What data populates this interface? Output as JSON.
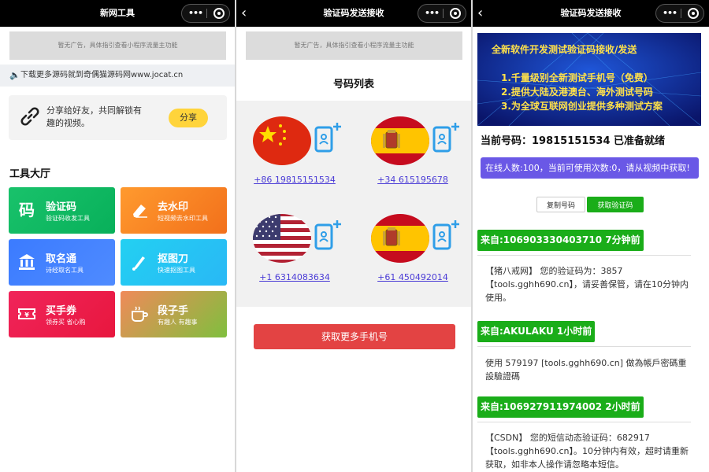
{
  "panel1": {
    "nav_title": "新网工具",
    "ad_text": "暂无广告，具体指引查看小程序流量主功能",
    "notice": "下载更多源码就到奇偶猫源码网www.jocat.cn",
    "share_text": "分享给好友，共同解锁有趣的视频。",
    "share_button": "分享",
    "section_title": "工具大厅",
    "tools": [
      {
        "name": "验证码",
        "sub": "验证码收发工具",
        "icon": "码",
        "color_from": "#19c26b",
        "color_to": "#08b05a"
      },
      {
        "name": "去水印",
        "sub": "短视频去水印工具",
        "icon": "eraser-icon",
        "color_from": "#ff9a2e",
        "color_to": "#f2701b"
      },
      {
        "name": "取名通",
        "sub": "诗经取名工具",
        "icon": "bank-icon",
        "color_from": "#3b7bff",
        "color_to": "#4f8bff"
      },
      {
        "name": "抠图刀",
        "sub": "快速抠图工具",
        "icon": "knife-icon",
        "color_from": "#23d0f2",
        "color_to": "#29b8f5"
      },
      {
        "name": "买手券",
        "sub": "领券买 省心购",
        "icon": "ticket-icon",
        "color_from": "#f0245a",
        "color_to": "#e8173e"
      },
      {
        "name": "段子手",
        "sub": "有趣人 有趣事",
        "icon": "coffee-icon",
        "color_from": "#f08a59",
        "color_to": "#7fbf3e"
      }
    ]
  },
  "panel2": {
    "nav_title": "验证码发送接收",
    "ad_text": "暂无广告，具体指引查看小程序流量主功能",
    "list_title": "号码列表",
    "numbers": [
      {
        "flag": "china-flag",
        "number": "+86 19815151534"
      },
      {
        "flag": "spain-flag",
        "number": "+34 615195678"
      },
      {
        "flag": "usa-flag",
        "number": "+1 6314083634"
      },
      {
        "flag": "spain-flag",
        "number": "+61 450492014"
      }
    ],
    "more_button": "获取更多手机号"
  },
  "panel3": {
    "nav_title": "验证码发送接收",
    "banner": {
      "headline": "全新软件开发测试验证码接收/发送",
      "lines": [
        "1.千量级别全新测试手机号（免费）",
        "2.提供大陆及港澳台、海外测试号码",
        "3.为全球互联网创业提供多种测试方案"
      ]
    },
    "current_number": "当前号码：19815151534 已准备就绪",
    "online_text": "在线人数:100，当前可使用次数:0，请从视频中获取!",
    "copy_button": "复制号码",
    "get_code_button": "获取验证码",
    "messages": [
      {
        "from": "来自:106903330403710 7分钟前",
        "body": "【猪八戒网】 您的验证码为：3857 【tools.gghh690.cn】，请妥善保管，请在10分钟内使用。"
      },
      {
        "from": "来自:AKULAKU 1小时前",
        "body": "使用 579197 [tools.gghh690.cn] 做為帳戶密碼重設驗證碼"
      },
      {
        "from": "来自:106927911974002 2小时前",
        "body": "【CSDN】 您的短信动态验证码：682917 【tools.gghh690.cn】。10分钟内有效，超时请重新获取，如非本人操作请忽略本短信。"
      }
    ]
  }
}
